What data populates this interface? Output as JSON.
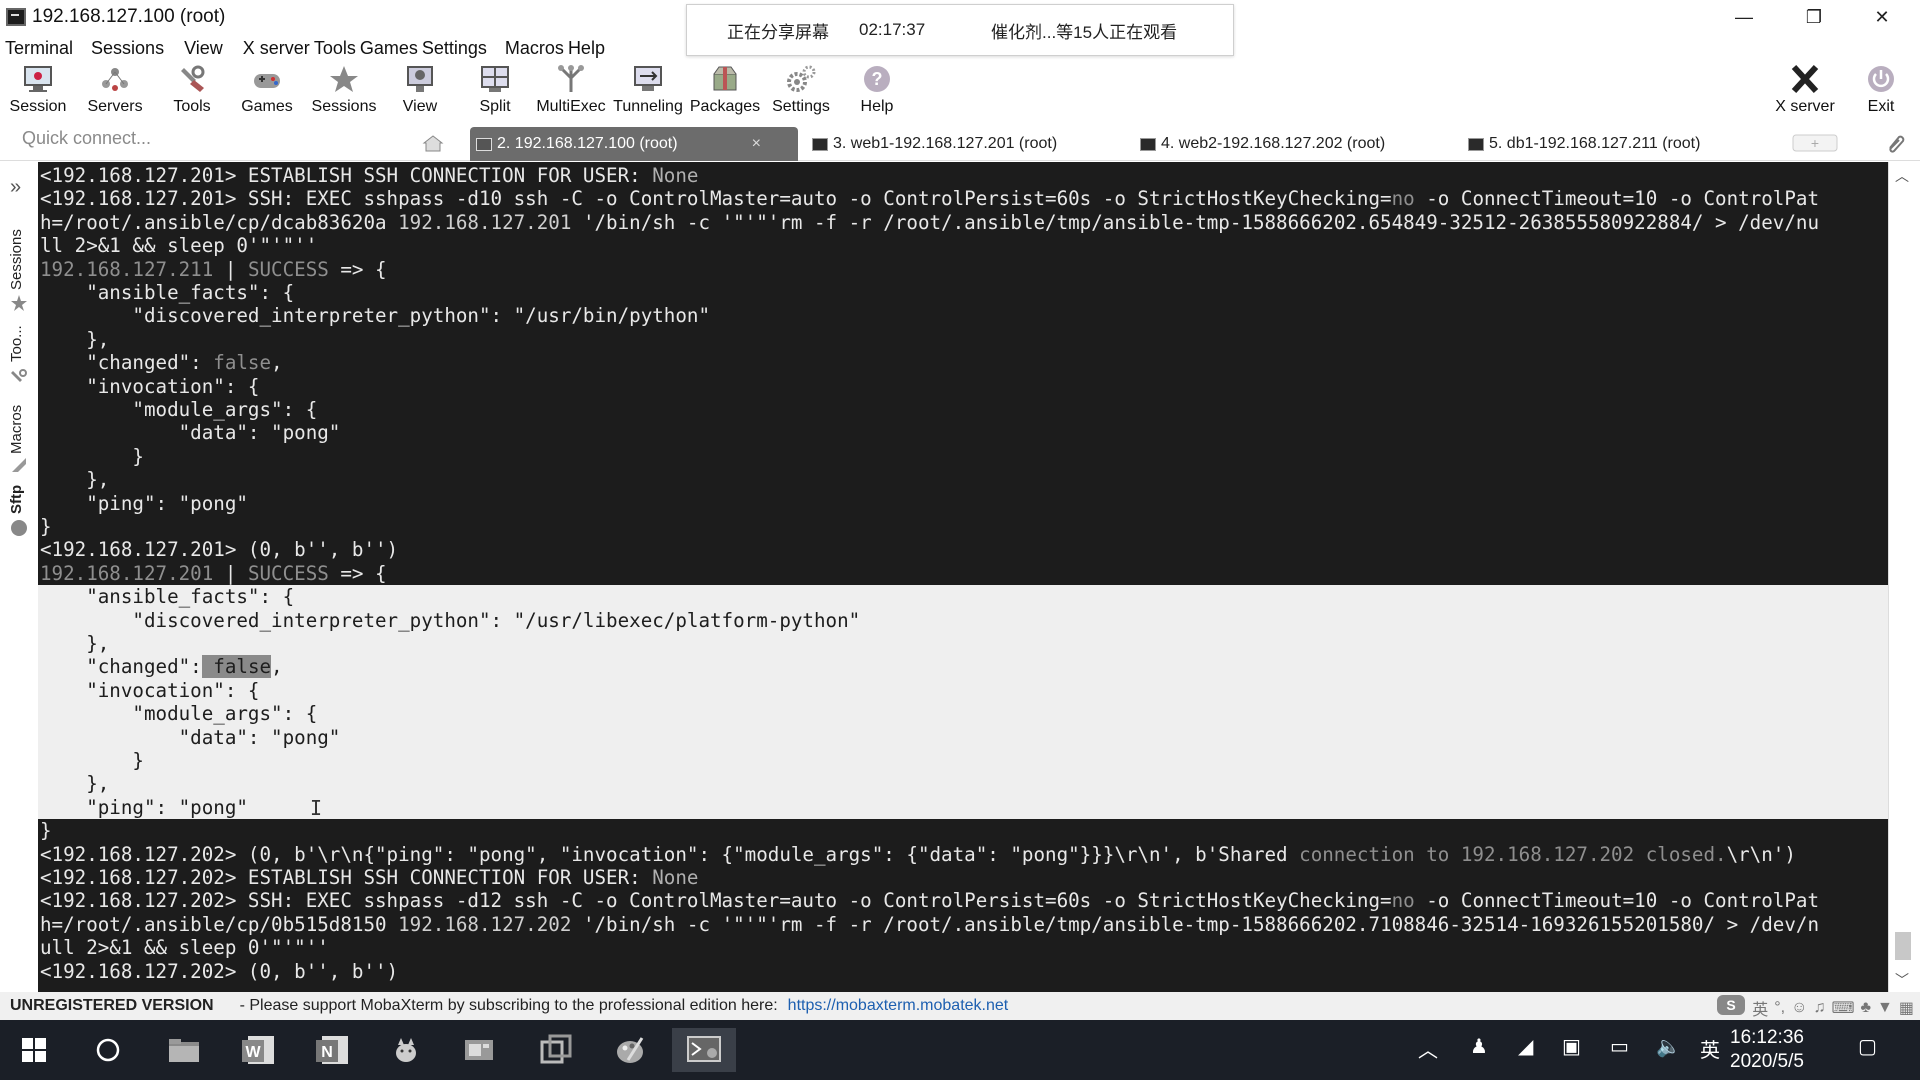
{
  "window": {
    "title": "192.168.127.100 (root)",
    "controls": {
      "minimize": "—",
      "restore": "❐",
      "close": "✕"
    }
  },
  "share_banner": {
    "status": "正在分享屏幕",
    "time": "02:17:37",
    "viewers": "催化剂...等15人正在观看"
  },
  "menu": [
    "Terminal",
    "Sessions",
    "View",
    "X server",
    "Tools",
    "Games",
    "Settings",
    "Macros",
    "Help"
  ],
  "toolbar": {
    "session": "Session",
    "servers": "Servers",
    "tools": "Tools",
    "games": "Games",
    "sessions": "Sessions",
    "view": "View",
    "split": "Split",
    "multiexec": "MultiExec",
    "tunneling": "Tunneling",
    "packages": "Packages",
    "settings": "Settings",
    "help": "Help",
    "xserver": "X server",
    "exit": "Exit"
  },
  "tabs": {
    "quick_connect": "Quick connect...",
    "items": [
      {
        "label": "2. 192.168.127.100 (root)",
        "active": true,
        "close": "×"
      },
      {
        "label": "3. web1-192.168.127.201 (root)"
      },
      {
        "label": "4. web2-192.168.127.202 (root)"
      },
      {
        "label": "5. db1-192.168.127.211 (root)"
      }
    ]
  },
  "sidebar": {
    "collapse": "»",
    "sessions": "Sessions",
    "tools": "Too...",
    "macros": "Macros",
    "sftp": "Sftp"
  },
  "terminal": {
    "l1a": "<192.168.127.201> ESTABLISH SSH CONNECTION FOR USER: ",
    "l1b": "None",
    "l2a": "<192.168.127.201> SSH: EXEC sshpass -d10 ssh -C -o ControlMaster=auto -o ControlPersist=60s -o StrictHostKeyChecking=",
    "l2b": "no",
    "l2c": " -o ConnectTimeout=10 -o ControlPat",
    "l3a": "h=/root/.ansible/cp/dcab83620a ",
    "l3b": "192.168.127.201",
    "l3c": " '/bin/sh -c '\"'\"'rm -f -r /root/.ansible/tmp/ansible-tmp-1588666202.654849-32512-263855580922884/ > /dev/nu",
    "l4": "ll 2>&1 && sleep 0'\"'\"''",
    "l5a": "192.168.127.211",
    "l5b": " | ",
    "l5c": "SUCCESS",
    "l5d": " => {",
    "l6": "    \"ansible_facts\": {",
    "l7": "        \"discovered_interpreter_python\": \"/usr/bin/python\"",
    "l8": "    },",
    "l9a": "    \"changed\": ",
    "l9b": "false",
    "l9c": ",",
    "l10": "    \"invocation\": {",
    "l11": "        \"module_args\": {",
    "l12": "            \"data\": \"pong\"",
    "l13": "        }",
    "l14": "    },",
    "l15": "    \"ping\": \"pong\"",
    "l16": "}",
    "l17": "<192.168.127.201> (0, b'', b'')",
    "l18a": "192.168.127.201",
    "l18b": " | ",
    "l18c": "SUCCESS",
    "l18d": " => {",
    "l19": "    \"ansible_facts\": {",
    "l20": "        \"discovered_interpreter_python\": \"/usr/libexec/platform-python\"",
    "l21": "    },",
    "l22a": "    \"changed\":",
    "l22b": " false",
    "l22c": ",",
    "l23": "    \"invocation\": {",
    "l24": "        \"module_args\": {",
    "l25": "            \"data\": \"pong\"",
    "l26": "        }",
    "l27": "    },",
    "l28": "    \"ping\": \"pong\"",
    "l29": "}",
    "l30a": "<192.168.127.202> (0, b'\\r\\n{\"ping\": \"pong\", \"invocation\": {\"module_args\": {\"data\": \"pong\"}}}\\r\\n', b'Shared ",
    "l30b": "connection to 192.168.127.202 closed.",
    "l30c": "\\r\\n')",
    "l31a": "<192.168.127.202> ESTABLISH SSH CONNECTION FOR USER: ",
    "l31b": "None",
    "l32a": "<192.168.127.202> SSH: EXEC sshpass -d12 ssh -C -o ControlMaster=auto -o ControlPersist=60s -o StrictHostKeyChecking=",
    "l32b": "no",
    "l32c": " -o ConnectTimeout=10 -o ControlPat",
    "l33a": "h=/root/.ansible/cp/0b515d8150 ",
    "l33b": "192.168.127.202",
    "l33c": " '/bin/sh -c '\"'\"'rm -f -r /root/.ansible/tmp/ansible-tmp-1588666202.7108846-32514-169326155201580/ > /dev/n",
    "l34": "ull 2>&1 && sleep 0'\"'\"''",
    "l35": "<192.168.127.202> (0, b'', b'')"
  },
  "statusbar": {
    "unregistered": "UNREGISTERED VERSION",
    "message": "-  Please support MobaXterm by subscribing to the professional edition here:",
    "url": "https://mobaxterm.mobatek.net"
  },
  "ime": {
    "lang": "英"
  },
  "taskbar": {
    "tray_lang": "英",
    "time": "16:12:36",
    "date": "2020/5/5"
  }
}
